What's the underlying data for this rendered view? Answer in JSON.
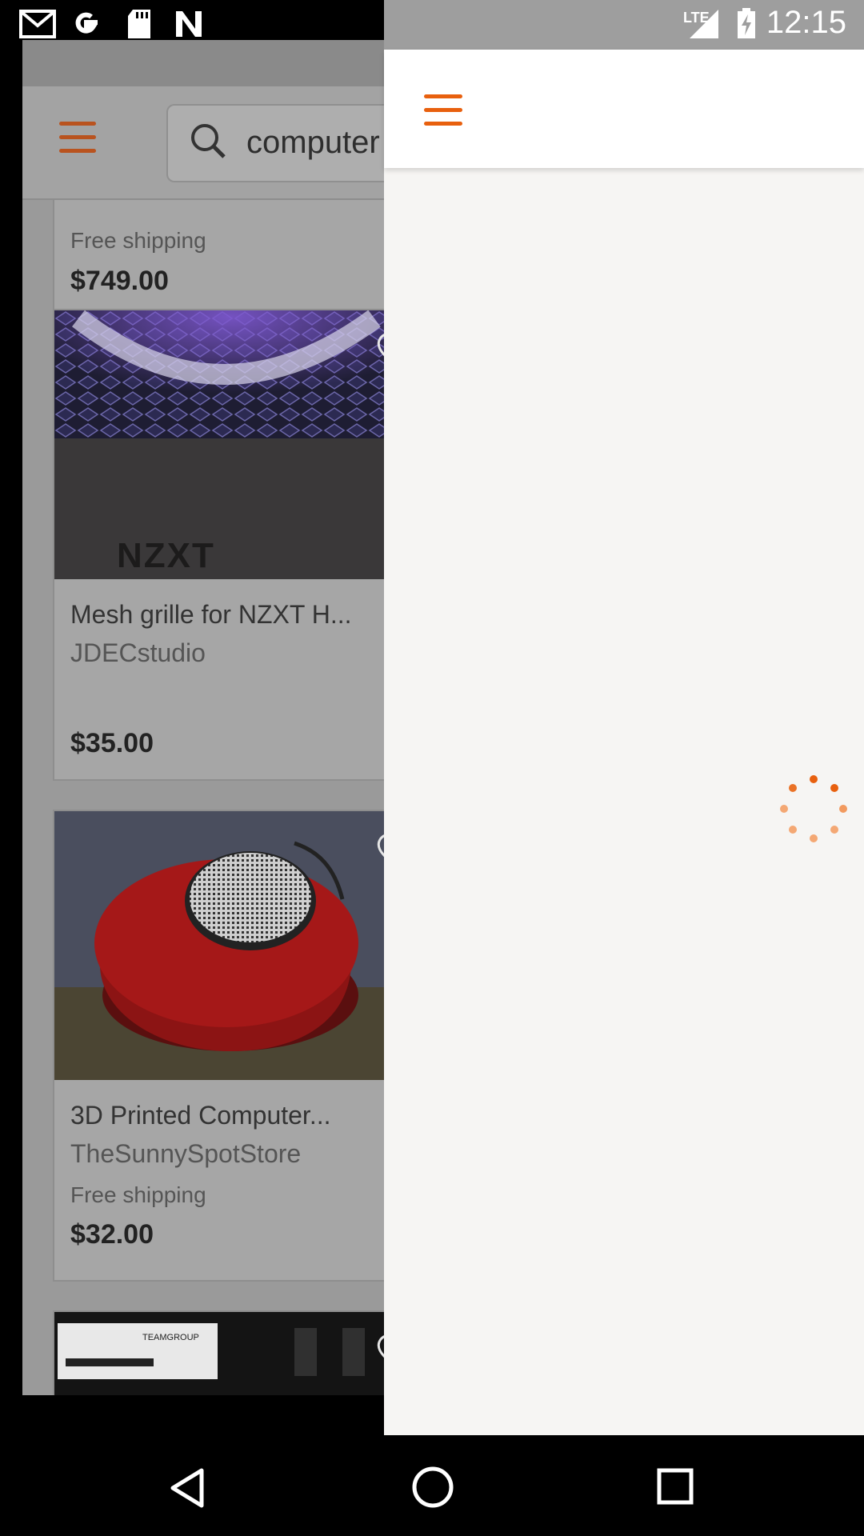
{
  "status_bar": {
    "time": "12:15",
    "network": "LTE",
    "left_icons": [
      "gmail-icon",
      "google-icon",
      "sd-card-icon",
      "n-icon"
    ],
    "right_icons": [
      "lte-signal-icon",
      "battery-charging-icon"
    ]
  },
  "background_app": {
    "search": {
      "value": "computer"
    },
    "listings": [
      {
        "title": "",
        "shop": "",
        "shipping": "Free shipping",
        "price": "$749.00"
      },
      {
        "title": "Mesh grille for NZXT H...",
        "shop": "JDECstudio",
        "shipping": "",
        "price": "$35.00",
        "image_text": "NZXT"
      },
      {
        "title": "3D Printed Computer...",
        "shop": "TheSunnySpotStore",
        "shipping": "Free shipping",
        "price": "$32.00"
      },
      {
        "title": "",
        "shop": "",
        "shipping": "",
        "price": "",
        "image_text": "TEAMGROUP"
      }
    ]
  },
  "drawer": {
    "menu_icon": "hamburger-menu-icon",
    "loading": true,
    "accent_color": "#e8600e"
  },
  "nav_bar": {
    "buttons": [
      "back-button",
      "home-button",
      "recents-button"
    ]
  }
}
